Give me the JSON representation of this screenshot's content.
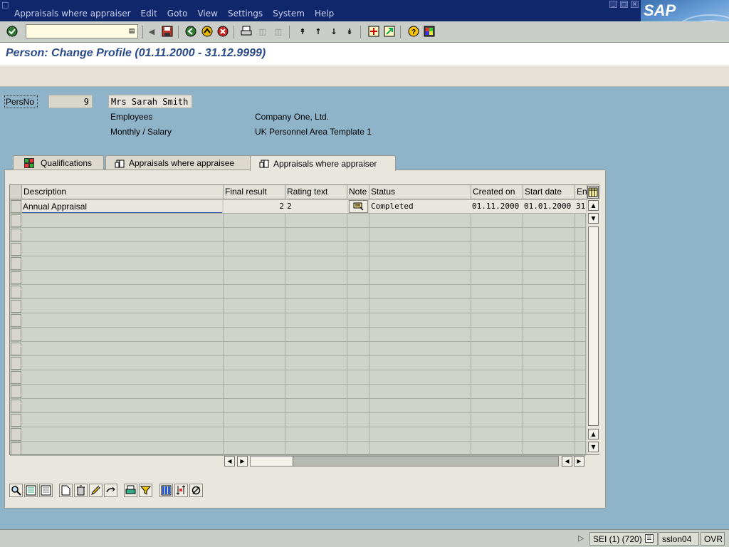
{
  "menu": {
    "items": [
      "Appraisals where appraiser",
      "Edit",
      "Goto",
      "View",
      "Settings",
      "System",
      "Help"
    ],
    "brand": "SAP"
  },
  "toolbar": {
    "command_value": "",
    "icons": [
      "enter-icon",
      "save-icon",
      "back-icon",
      "exit-icon",
      "cancel-icon",
      "print-icon",
      "find-icon",
      "find-next-icon",
      "first-page-icon",
      "previous-page-icon",
      "next-page-icon",
      "last-page-icon",
      "create-session-icon",
      "shortcut-icon",
      "help-icon",
      "layout-icon"
    ]
  },
  "title": "Person: Change Profile (01.11.2000 - 31.12.9999)",
  "header": {
    "persno_label": "PersNo",
    "persno_value": "9",
    "name": "Mrs Sarah Smith",
    "group": "Employees",
    "company": "Company One, Ltd.",
    "subgroup": "Monthly / Salary",
    "area": "UK Personnel Area Template 1"
  },
  "tabs": [
    {
      "label": "Qualifications",
      "active": false
    },
    {
      "label": "Appraisals where appraisee",
      "active": false
    },
    {
      "label": "Appraisals where appraiser",
      "active": true
    }
  ],
  "table": {
    "columns": [
      "Description",
      "Final result",
      "Rating text",
      "Note",
      "Status",
      "Created on",
      "Start date",
      "En"
    ],
    "rows": [
      {
        "description": "Annual Appraisal",
        "final_result": "2",
        "rating_text": "2",
        "note": "note-icon",
        "status": "Completed",
        "created_on": "01.11.2000",
        "start_date": "01.01.2000",
        "end": "31"
      }
    ],
    "empty_rows": 17
  },
  "statusbar": {
    "system": "SEI (1) (720)",
    "server": "sslon04",
    "mode": "OVR"
  }
}
